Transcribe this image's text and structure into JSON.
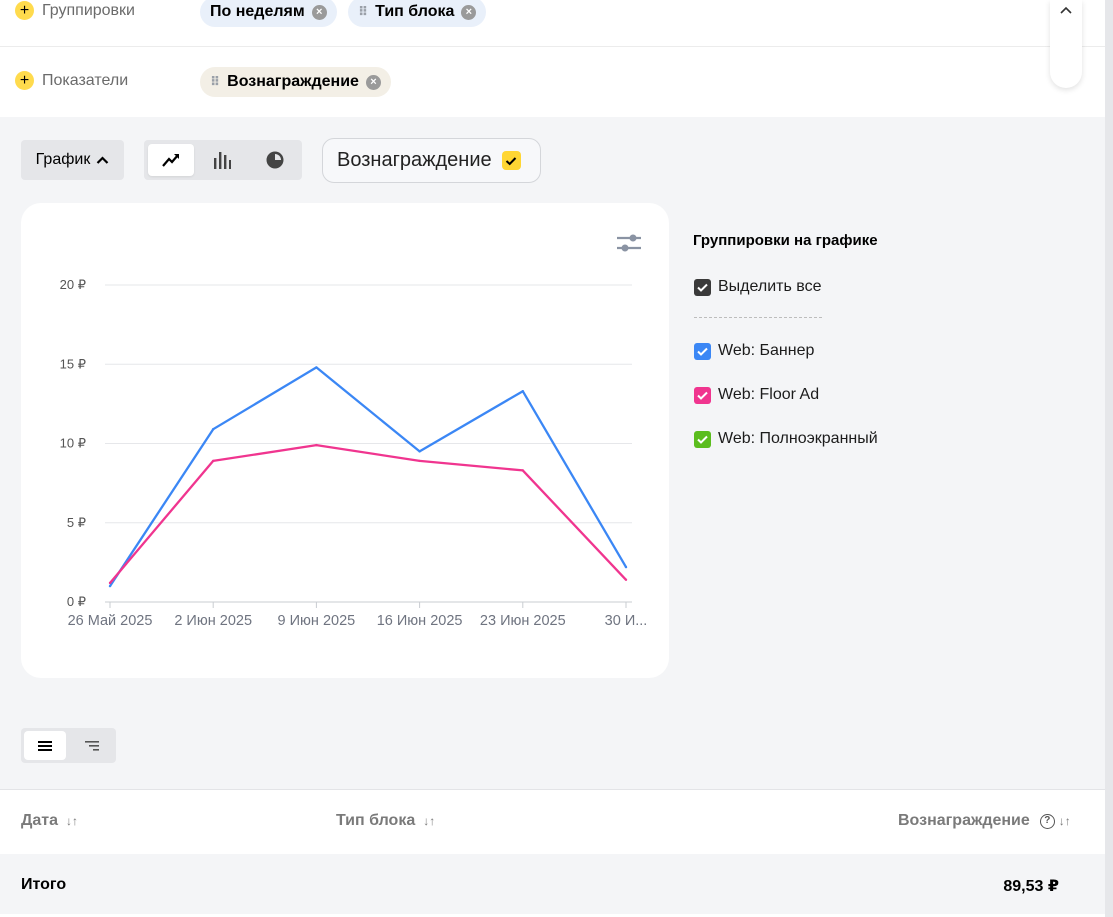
{
  "filters": {
    "groupings_label": "Группировки",
    "metrics_label": "Показатели",
    "grouping_chips": [
      "По неделям",
      "Тип блока"
    ],
    "metric_chips": [
      "Вознаграждение"
    ]
  },
  "chart_controls": {
    "grafik_label": "График",
    "metric_toggle_label": "Вознаграждение",
    "chart_types": [
      "line-chart-icon",
      "bar-chart-icon",
      "pie-chart-icon"
    ],
    "active_type": "line"
  },
  "legend": {
    "title": "Группировки на графике",
    "select_all": "Выделить все",
    "items": [
      {
        "label": "Web: Баннер",
        "color": "#3b87f5"
      },
      {
        "label": "Web: Floor Ad",
        "color": "#f0358f"
      },
      {
        "label": "Web: Полноэкранный",
        "color": "#5bbd1e"
      }
    ]
  },
  "chart_data": {
    "type": "line",
    "x": [
      "26 Май 2025",
      "2 Июн 2025",
      "9 Июн 2025",
      "16 Июн 2025",
      "23 Июн 2025",
      "30 И..."
    ],
    "ylim": [
      0,
      20
    ],
    "y_ticks": [
      "0 ₽",
      "5 ₽",
      "10 ₽",
      "15 ₽",
      "20 ₽"
    ],
    "grid": true,
    "series": [
      {
        "name": "Web: Баннер",
        "color": "#3b87f5",
        "values": [
          1.0,
          10.9,
          14.8,
          9.5,
          13.3,
          2.2
        ]
      },
      {
        "name": "Web: Floor Ad",
        "color": "#f0358f",
        "values": [
          1.2,
          8.9,
          9.9,
          8.9,
          8.3,
          1.4
        ]
      }
    ]
  },
  "table": {
    "columns": [
      "Дата",
      "Тип блока",
      "Вознаграждение"
    ],
    "total_label": "Итого",
    "total_value": "89,53 ₽"
  }
}
